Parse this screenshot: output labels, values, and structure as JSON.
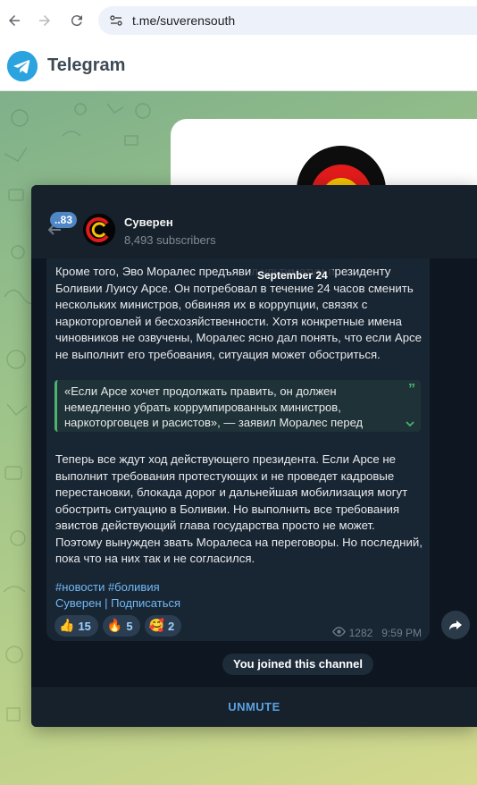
{
  "browser": {
    "url": "t.me/suverensouth"
  },
  "header": {
    "title": "Telegram"
  },
  "channel": {
    "unread": "..83",
    "name": "Суверен",
    "subscribers": "8,493 subscribers"
  },
  "message": {
    "date": "September 24",
    "paragraph1": "Кроме того, Эво Моралес предъявил ультиматум президенту Боливии Луису Арсе. Он потребовал в течение 24 часов сменить нескольких министров, обвиняя их в коррупции, связях с наркоторговлей и бесхозяйственности. Хотя конкретные имена чиновников не озвучены, Моралес ясно дал понять, что если Арсе не выполнит его требования, ситуация может обостриться.",
    "quote": "«Если Арсе хочет продолжать править, он должен немедленно убрать коррумпированных министров, наркоторговцев и расистов», — заявил Моралес перед",
    "paragraph2": "Теперь все ждут ход действующего президента. Если Арсе не выполнит требования протестующих и не проведет кадровые перестановки, блокада дорог и дальнейшая мобилизация могут обострить ситуацию в Боливии. Но выполнить все требования эвистов действующий глава государства просто не может. Поэтому вынужден звать Моралеса на переговоры. Но последний, пока что на них так и не согласился.",
    "hashtags": "#новости #боливия",
    "channel_link": "Суверен | Подписаться",
    "views": "1282",
    "time": "9:59 PM",
    "reactions": [
      {
        "emoji": "👍",
        "count": "15"
      },
      {
        "emoji": "🔥",
        "count": "5"
      },
      {
        "emoji": "🥰",
        "count": "2"
      }
    ]
  },
  "service": {
    "joined": "You joined this channel"
  },
  "bottom": {
    "unmute": "UNMUTE"
  }
}
